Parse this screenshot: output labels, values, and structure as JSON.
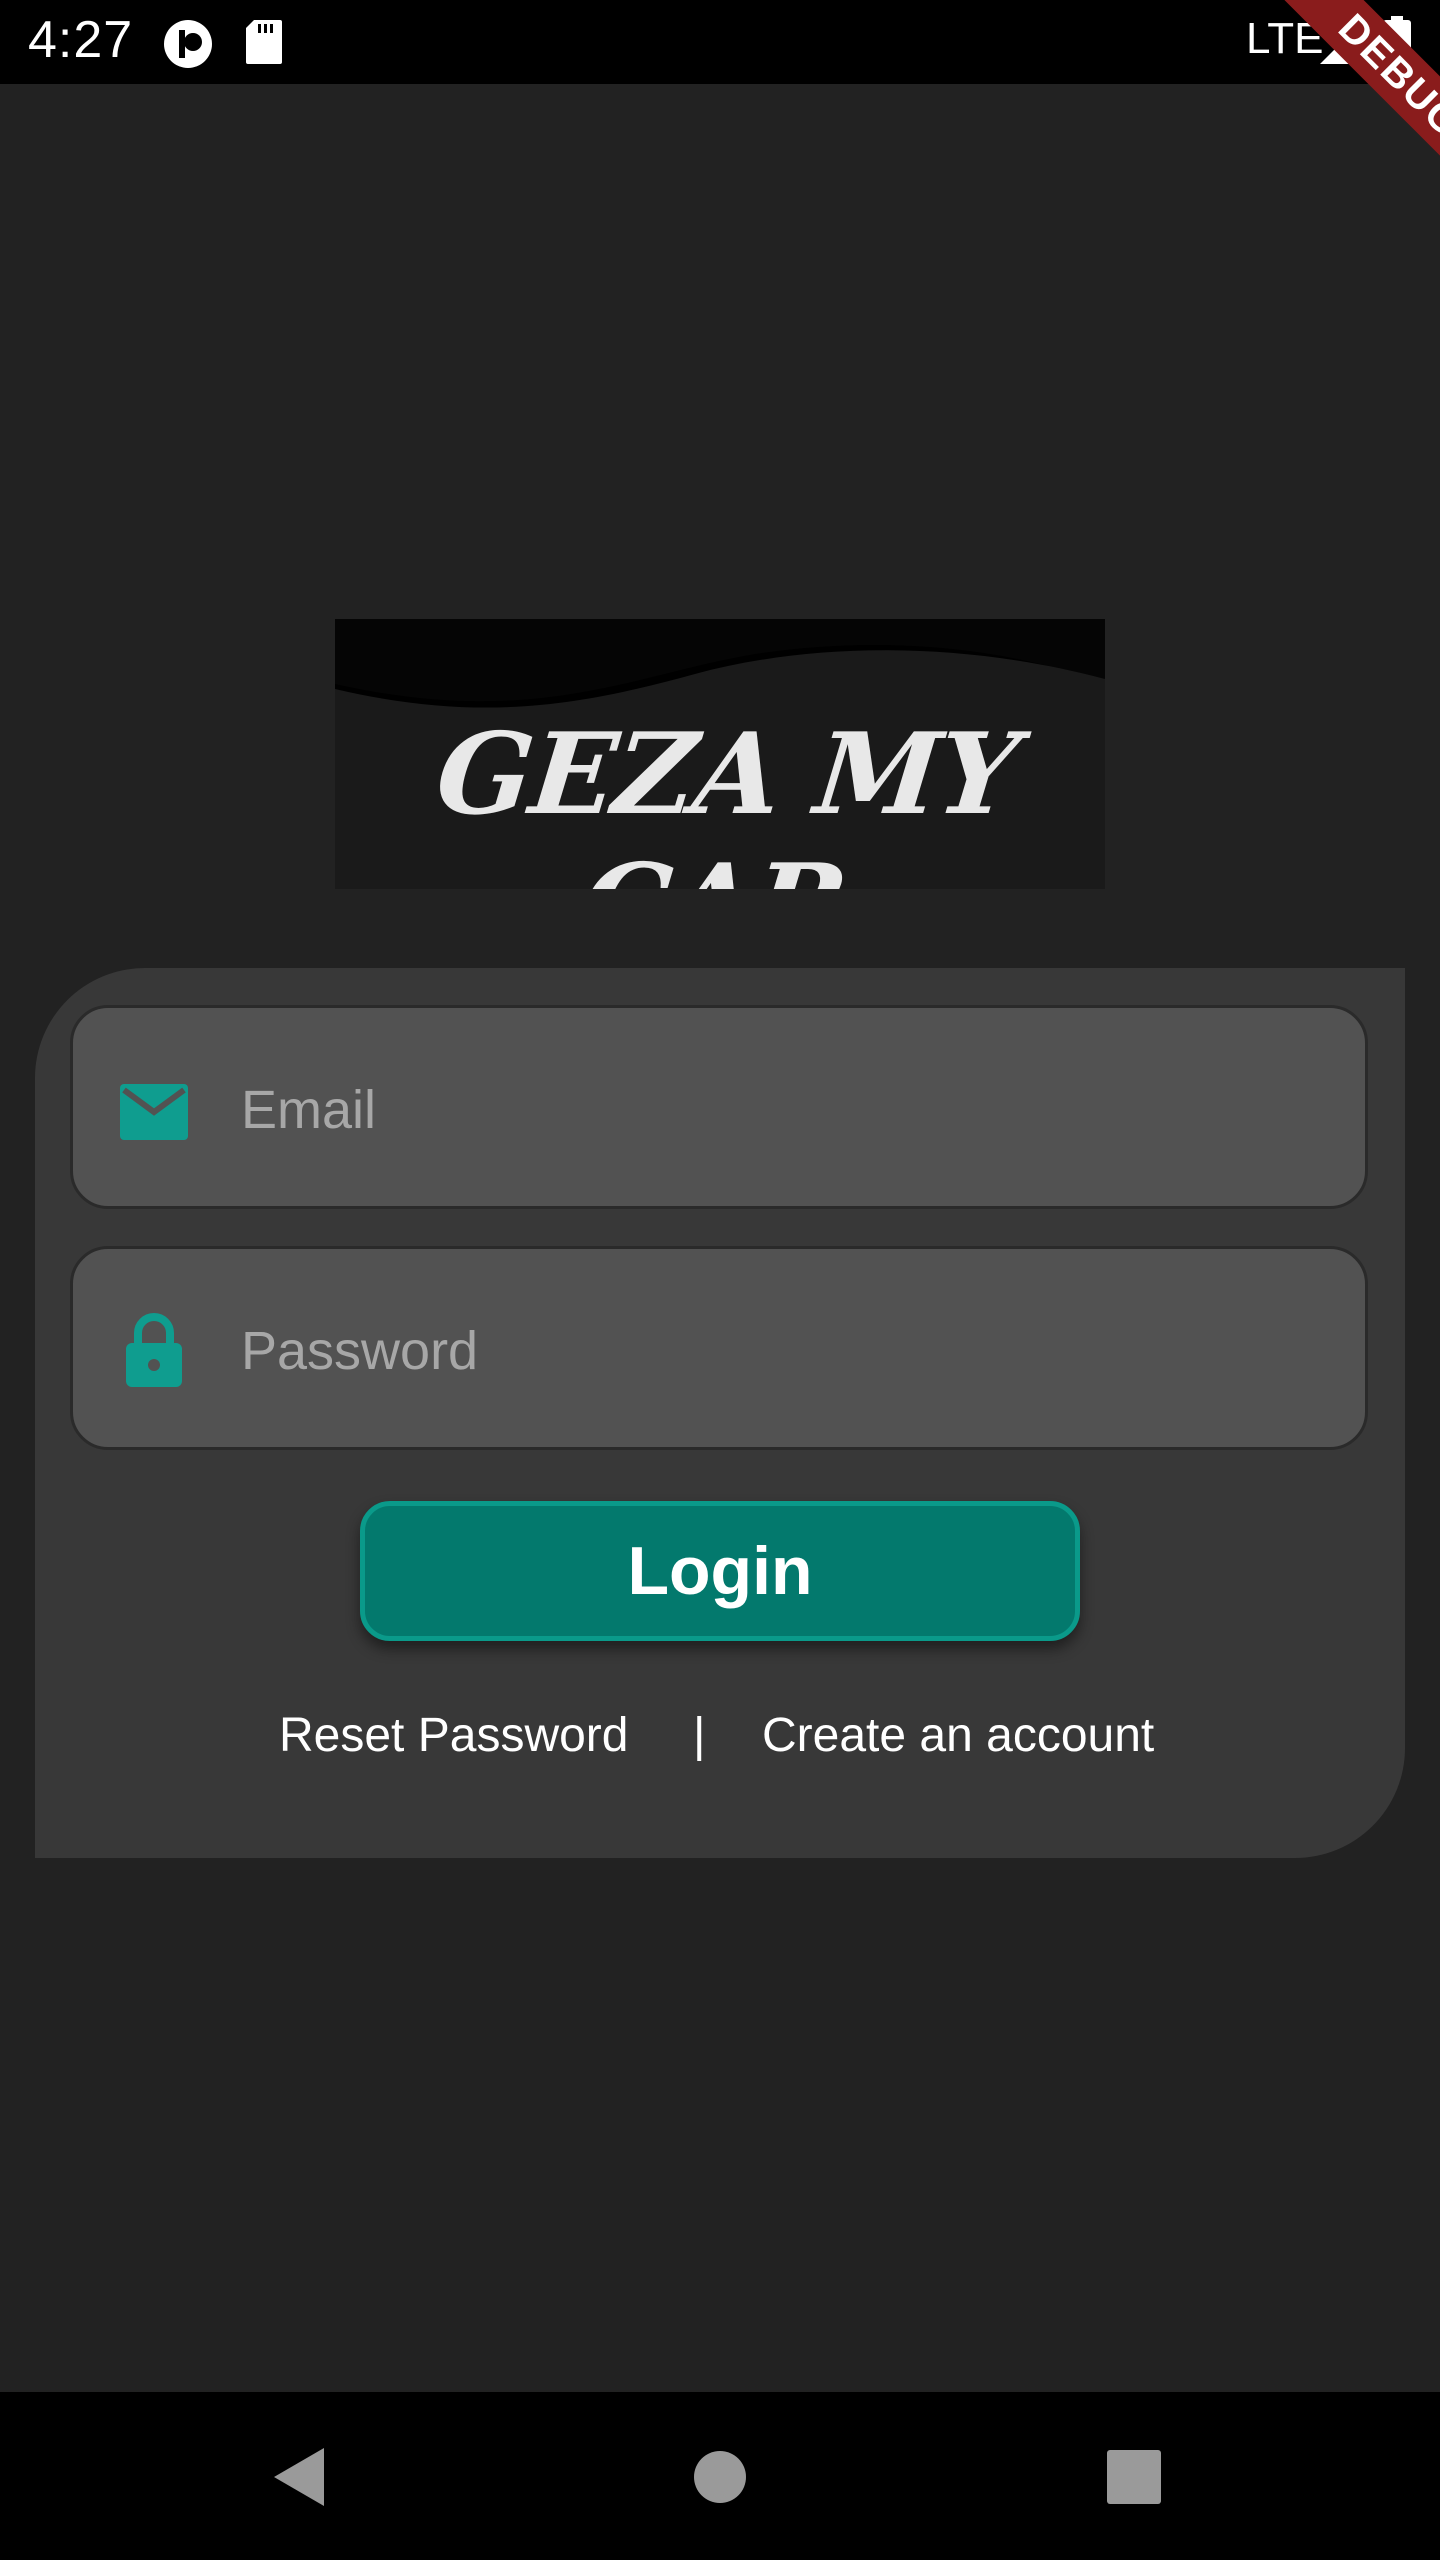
{
  "status_bar": {
    "time": "4:27",
    "network": "LTE",
    "icons": [
      "notification-app-icon",
      "sd-card-icon",
      "signal-icon",
      "battery-icon"
    ]
  },
  "debug_banner": {
    "label": "DEBUG",
    "color": "#8a1c1c"
  },
  "logo": {
    "text": "GEZA MY CAR"
  },
  "login_form": {
    "email": {
      "placeholder": "Email",
      "value": "",
      "icon": "email-icon"
    },
    "password": {
      "placeholder": "Password",
      "value": "",
      "icon": "lock-icon"
    },
    "login_label": "Login",
    "reset_password_label": "Reset Password",
    "divider": "|",
    "create_account_label": "Create an account"
  },
  "colors": {
    "background": "#222222",
    "card": "#383838",
    "field": "#525252",
    "accent": "#03796d",
    "icon_accent": "#0f9d8f"
  },
  "nav_bar": {
    "buttons": [
      "back-icon",
      "home-icon",
      "recents-icon"
    ]
  }
}
